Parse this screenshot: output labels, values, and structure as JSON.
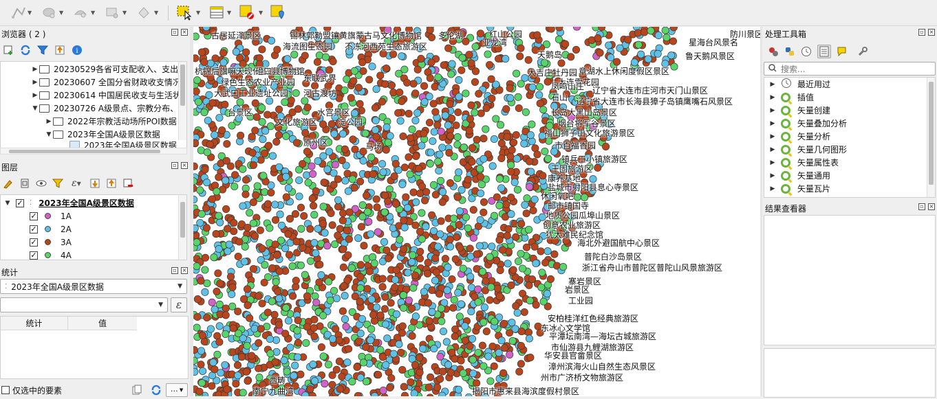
{
  "browser": {
    "title": "浏览器 ( 2 )",
    "items": [
      {
        "label": "20230529各省可支配收入、支出"
      },
      {
        "label": "20230607 全国分省财政收支情况"
      },
      {
        "label": "20230614 中国居民收支与生活状"
      },
      {
        "label": "20230726 A级景点、宗教分布、"
      },
      {
        "label": "2022年宗教活动场所POI数据"
      },
      {
        "label": "2023年全国A级景区数据"
      },
      {
        "label": "2023年全国A级景区数据"
      }
    ]
  },
  "layers": {
    "title": "图层",
    "layer_name": "2023年全国A级景区数据",
    "legend": [
      {
        "label": "1A",
        "color": "#d062c8"
      },
      {
        "label": "2A",
        "color": "#5fc1e6"
      },
      {
        "label": "3A",
        "color": "#b8451c"
      },
      {
        "label": "4A",
        "color": "#58d46b"
      }
    ]
  },
  "stats": {
    "title": "统计",
    "layer_select": "2023年全国A级景区数据",
    "col_stat": "统计",
    "col_value": "值",
    "selected_only": "仅选中的要素",
    "more": "…"
  },
  "processing": {
    "title": "处理工具箱",
    "search_placeholder": "搜索...",
    "items": [
      {
        "label": "最近用过",
        "icon": "clock-icon"
      },
      {
        "label": "插值",
        "icon": "qgis-icon"
      },
      {
        "label": "矢量创建",
        "icon": "qgis-icon"
      },
      {
        "label": "矢量叠加分析",
        "icon": "qgis-icon"
      },
      {
        "label": "矢量分析",
        "icon": "qgis-icon"
      },
      {
        "label": "矢量几何图形",
        "icon": "qgis-icon"
      },
      {
        "label": "矢量属性表",
        "icon": "qgis-icon"
      },
      {
        "label": "矢量通用",
        "icon": "qgis-icon"
      },
      {
        "label": "矢量瓦片",
        "icon": "qgis-icon"
      }
    ]
  },
  "results": {
    "title": "结果查看器"
  },
  "map_labels": [
    "古居延泽景区",
    "锡林郭勒盟镶黄旗蒙古马文化博物馆",
    "多伦湖",
    "红山公园",
    "防川景区",
    "海流图生态园",
    "不冻河西苑生态旅游区",
    "亚龙湾",
    "天鹅岛",
    "星海台风景名",
    "鲁天鹅风景区",
    "杭锦后旗嘛天现代农业旅游区",
    "磴口县博物馆",
    "大吉庄牡丹园",
    "章湖水上休闲度假区景区",
    "东联武界",
    "大连雪花园",
    "绿色生态农业产业园",
    "凤鸣山庄",
    "辽宁省大连市庄河市天门山景区",
    "大武口工业遗址公园",
    "河古渡坊",
    "石山",
    "辽宁省大连市长海县獐子岛镇鹰嘴石风景区",
    "台景区",
    "水宫景区",
    "淀公园",
    "长岛大黑山岛景区",
    "文化旅游区",
    "烟台将军谷景区",
    "福山狮子山文化旅游景区",
    "原州区",
    "马场",
    "市百福香园",
    "镇兵工小镇旅游区",
    "王固旅游区",
    "康养基地",
    "盐城市射阳县息心寺景区",
    "休闲氧吧",
    "邮市镇国寺",
    "地质公园瓜埠山景区",
    "创意农业旅游区",
    "犹太难民纪念馆",
    "海北外避国航中心景区",
    "普陀白沙岛景区",
    "浙江省舟山市普陀区普陀山风景旅游区",
    "寨岩景区",
    "岩景区",
    "工业园",
    "安柏桂洋红色经典旅游区",
    "东冰心文学馆",
    "平潭坛南湾—海坛古城旅游区",
    "市仙游县九鲤湖旅游区",
    "华安县官畲景区",
    "漳州滨海火山自然生态风景区",
    "州市广济桥文物旅游区",
    "揭阳市惠来县海滨度假村景区",
    "南宁九曲湾",
    "西畴"
  ]
}
